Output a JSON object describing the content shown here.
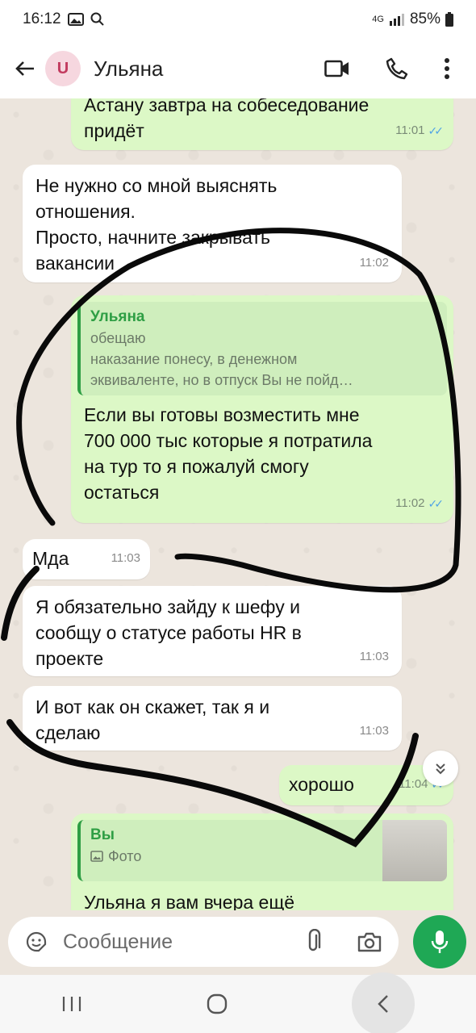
{
  "status": {
    "time": "16:12",
    "network": "4G",
    "battery": "85%"
  },
  "header": {
    "avatar_letter": "U",
    "contact_name": "Ульяна"
  },
  "messages": [
    {
      "text": "Астану завтра на собеседование\nпридёт",
      "time": "11:01"
    },
    {
      "text": "Не нужно со мной выяснять\nотношения.\nПросто, начните закрывать\nвакансии",
      "time": "11:02"
    },
    {
      "quote_name": "Ульяна",
      "quote_text": "обещаю\nнаказание понесу, в денежном\nэквиваленте, но в отпуск Вы не пойд…",
      "text": "Если вы готовы возместить мне\n700 000 тыс которые я потратила\nна тур то я пожалуй смогу\nостаться",
      "time": "11:02"
    },
    {
      "text": "Мда",
      "time": "11:03"
    },
    {
      "text": "Я обязательно зайду к шефу и\nсообщу о статусе работы HR в\nпроекте",
      "time": "11:03"
    },
    {
      "text": "И вот как он скажет, так я и\nсделаю",
      "time": "11:03"
    },
    {
      "text": "хорошо",
      "time": "11:04"
    },
    {
      "quote_name": "Вы",
      "quote_text": "Фото",
      "text": "Ульяна я вам вчера ещё"
    }
  ],
  "input": {
    "placeholder": "Сообщение"
  },
  "colors": {
    "outgoing": "#dcf8c6",
    "incoming": "#ffffff",
    "accent": "#1fa855",
    "read_ticks": "#4fa3e6"
  },
  "icons": [
    "back-arrow-icon",
    "video-call-icon",
    "phone-icon",
    "more-icon",
    "sticker-icon",
    "attach-icon",
    "camera-icon",
    "mic-icon",
    "recents-icon",
    "home-icon",
    "nav-back-icon",
    "scroll-down-icon",
    "photo-icon",
    "read-ticks-icon"
  ]
}
